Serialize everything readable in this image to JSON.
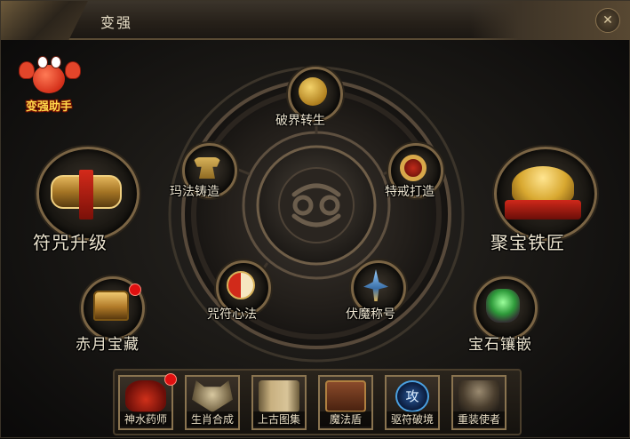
{
  "window": {
    "title": "变强"
  },
  "helper": {
    "label": "变强助手"
  },
  "center": {
    "emblem": "spiral-emblem-icon"
  },
  "ring_nodes": [
    {
      "id": "rebirth",
      "label": "破界转生",
      "icon": "golden-dragon-coin-icon"
    },
    {
      "id": "forge",
      "label": "玛法铸造",
      "icon": "anvil-icon"
    },
    {
      "id": "ring",
      "label": "特戒打造",
      "icon": "ruby-ring-icon"
    },
    {
      "id": "curse",
      "label": "咒符心法",
      "icon": "yin-yang-icon"
    },
    {
      "id": "demon",
      "label": "伏魔称号",
      "icon": "winged-sword-icon"
    }
  ],
  "side_nodes": [
    {
      "id": "talisman",
      "label": "符咒升级",
      "icon": "scroll-talisman-icon"
    },
    {
      "id": "treasure",
      "label": "聚宝铁匠",
      "icon": "gold-ingot-icon"
    },
    {
      "id": "moon",
      "label": "赤月宝藏",
      "icon": "treasure-chest-icon",
      "notify": true
    },
    {
      "id": "gem",
      "label": "宝石镶嵌",
      "icon": "gem-ore-icon"
    }
  ],
  "bottom_items": [
    {
      "label": "神水药师",
      "icon": "potion-jar-icon",
      "notify": true
    },
    {
      "label": "生肖合成",
      "icon": "zodiac-mask-icon"
    },
    {
      "label": "上古图集",
      "icon": "ancient-scroll-icon"
    },
    {
      "label": "魔法盾",
      "icon": "spell-book-icon"
    },
    {
      "label": "驱符破境",
      "icon": "attack-rune-icon",
      "glyph": "攻"
    },
    {
      "label": "重装使者",
      "icon": "armored-warrior-icon"
    }
  ],
  "colors": {
    "gold": "#c9a15a",
    "label_text": "#ece4cf",
    "notify_red": "#e01010",
    "helper_text": "#ffd84a"
  }
}
